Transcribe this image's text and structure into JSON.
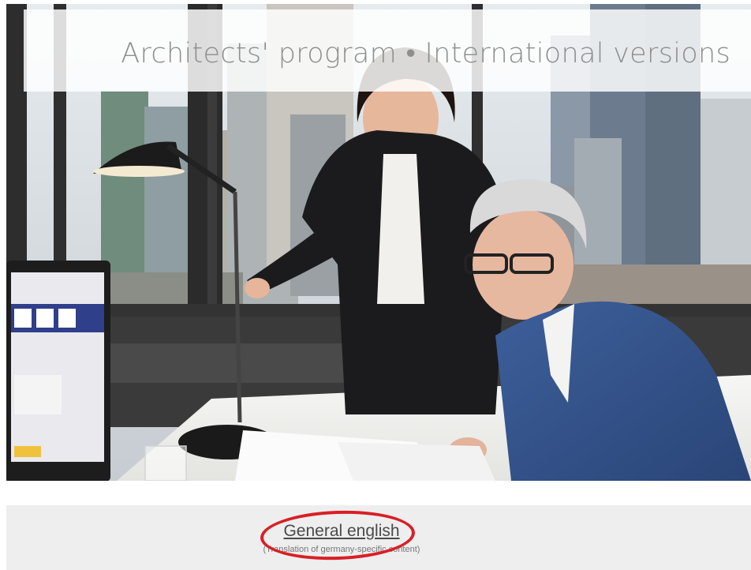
{
  "hero": {
    "title": "Architects' program • International versions"
  },
  "languages": [
    {
      "label": "General english",
      "note": "(Translation of germany-specific content)"
    }
  ],
  "colors": {
    "highlight": "#d81f26",
    "title_text": "#8e8e8e",
    "panel_background": "#eeeeee"
  }
}
